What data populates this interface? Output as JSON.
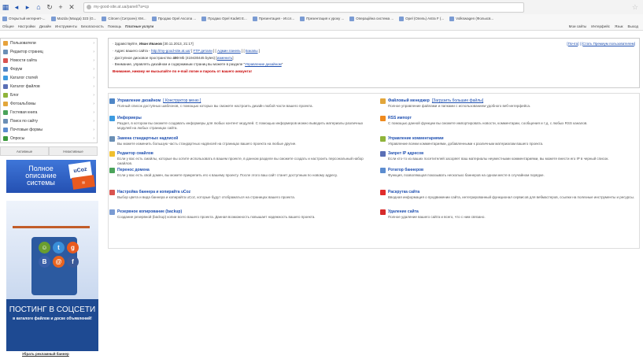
{
  "browser": {
    "url": "my-good-site.at.ua/panel/?a=cp",
    "bookmarks": [
      "Открытый интернет-...",
      "Mazda (Мазда) 323 (G...",
      "Citroen (Ситроен) XM...",
      "Продаю Opel Ascona ...",
      "Продаю Opel Kadett E...",
      "Презентация - Иссл...",
      "Презентация к уроку ...",
      "Операційна система ...",
      "Opel (Опель) Astra F (...",
      "Volkswagen (Фольксв..."
    ],
    "menu": [
      "Общее",
      "Настройки",
      "Дизайн",
      "Инструменты",
      "Безопасность",
      "Помощь"
    ],
    "menu_bold": "Платные услуги",
    "menu_right": [
      "Мои сайты",
      "Интерфейс",
      "Язык",
      "Выход"
    ]
  },
  "sidebar": {
    "items": [
      {
        "label": "Пользователи",
        "icon": "users-icon"
      },
      {
        "label": "Редактор страниц",
        "icon": "page-editor-icon"
      },
      {
        "label": "Новости сайта",
        "icon": "news-icon"
      },
      {
        "label": "Форум",
        "icon": "forum-icon"
      },
      {
        "label": "Каталог статей",
        "icon": "articles-icon"
      },
      {
        "label": "Каталог файлов",
        "icon": "files-icon"
      },
      {
        "label": "Блог",
        "icon": "blog-icon"
      },
      {
        "label": "Фотоальбомы",
        "icon": "photo-icon"
      },
      {
        "label": "Гостевая книга",
        "icon": "guestbook-icon"
      },
      {
        "label": "Поиск по сайту",
        "icon": "search-icon"
      },
      {
        "label": "Почтовые формы",
        "icon": "mail-form-icon"
      },
      {
        "label": "Опросы",
        "icon": "poll-icon"
      }
    ],
    "tabs": [
      "Активные",
      "Неактивные"
    ]
  },
  "banner1": {
    "text": "Полное описание системы",
    "logo": "uCoz"
  },
  "banner2": {
    "title": "ПОСТИНГ В СОЦСЕТИ",
    "subtitle": "в каталоге файлов и доске объявлений!",
    "link": "Убрать рекламный баннер"
  },
  "info": {
    "greeting": "Здравствуйте,",
    "user": "Иван Иванов",
    "datetime": "[30.11.2013, 21:17]",
    "address_label": "Адрес вашего сайта -",
    "address": "http://my-good-site.at.ua/",
    "address_links": [
      "FTP детали",
      "Админ панель",
      "Бэкапы"
    ],
    "space_label": "Доступное дисковое пространство",
    "space_mb": "400",
    "space_rest": "Mb (419430445 bytes)",
    "space_link": "изменить",
    "design_note": "Внимание, управлять дизайном и содержимым страниц вы можете в разделе",
    "design_link": "Управление дизайном",
    "warning": "Внимание, никому не высылайте по e-mail логин и пароль от вашего аккаунта!",
    "right_links": [
      "Почта",
      "Стать Премиум пользователем"
    ]
  },
  "modules": [
    {
      "title": "Управление дизайном",
      "extra": "[ Конструктор меню ]",
      "desc": "Полный список доступных шаблонов, с помощью которых вы сможете настроить дизайн любой части вашего проекта.",
      "icon": "design-icon",
      "color": "#4f86c6"
    },
    {
      "title": "Файловый менеджер",
      "extra": "[Загрузить большие файлы]",
      "desc": "Полное управление файлами и папками с использованием удобного веб-интерфейса.",
      "icon": "folder-icon",
      "color": "#e2a63a"
    },
    {
      "title": "Информеры",
      "extra": "",
      "desc": "Раздел, в котором вы сможете создавать информеры для любых контент модулей. С помощью информеров можно выводить материалы различных модулей на любых страницах сайта.",
      "icon": "informer-icon",
      "color": "#3d9be0"
    },
    {
      "title": "RSS импорт",
      "extra": "",
      "desc": "С помощью данной функции вы сможете импортировать новости, комментарии, сообщения и т.д. с любых RSS каналов.",
      "icon": "rss-icon",
      "color": "#ef8a1e"
    },
    {
      "title": "Замена стандартных надписей",
      "extra": "",
      "desc": "Вы можете изменить большую часть стандартных надписей на страницах вашего проекта на любые другие.",
      "icon": "labels-icon",
      "color": "#6b8fb5"
    },
    {
      "title": "Управление комментариями",
      "extra": "",
      "desc": "Управление всеми комментариями, добавленными к различным материалам вашего проекта.",
      "icon": "comments-icon",
      "color": "#8fb43a"
    },
    {
      "title": "Редактор смайлов",
      "extra": "",
      "desc": "Если у вас есть смайлы, которые вы хотите использовать в вашем проекте, в данном разделе вы сможете создать и настроить персональный набор смайлов.",
      "icon": "smile-icon",
      "color": "#f0c030"
    },
    {
      "title": "Запрет IP адресов",
      "extra": "",
      "desc": "Если кто-то из ваших посетителей засоряет ваш материалы неуместными комментариями, вы можете внести его IP в черный список.",
      "icon": "ban-ip-icon",
      "color": "#5a6fb5"
    },
    {
      "title": "Перенос домена",
      "extra": "",
      "desc": "Если у вас есть свой домен, вы можете прикрепить его к вашему проекту. После этого ваш сайт станет доступным по новому адресу.",
      "icon": "domain-icon",
      "color": "#4aa35a"
    },
    {
      "title": "Ротатор баннеров",
      "extra": "",
      "desc": "Функция, позволяющая показывать несколько баннеров на одном месте в случайном порядке.",
      "icon": "banner-rotator-icon",
      "color": "#5b8ccf"
    },
    {
      "title": "Настройка баннера и копирайта uCoz",
      "extra": "",
      "desc": "Выбор цвета и вида баннера и копирайта uCoz, которые будут отображаться на страницах вашего проекта.",
      "icon": "ucoz-banner-icon",
      "color": "#d9534f"
    },
    {
      "title": "Раскрутка сайта",
      "extra": "",
      "desc": "Вводная информация о продвижении сайта, интегрированный функционал сервисов для вебмастеров, ссылки на полезные инструменты и ресурсы.",
      "icon": "promotion-icon",
      "color": "#e02c2c"
    },
    {
      "title": "Резервное копирование (backup)",
      "extra": "",
      "desc": "Создание резервной (backup) копии всего вашего проекта. Данная возможность повышает надежность вашего проекта.",
      "icon": "backup-icon",
      "color": "#7a9bd3"
    },
    {
      "title": "Удаление сайта",
      "extra": "",
      "desc": "Полное удаление вашего сайта и всего, что с ним связано.",
      "icon": "delete-icon",
      "color": "#d62b2b"
    }
  ]
}
